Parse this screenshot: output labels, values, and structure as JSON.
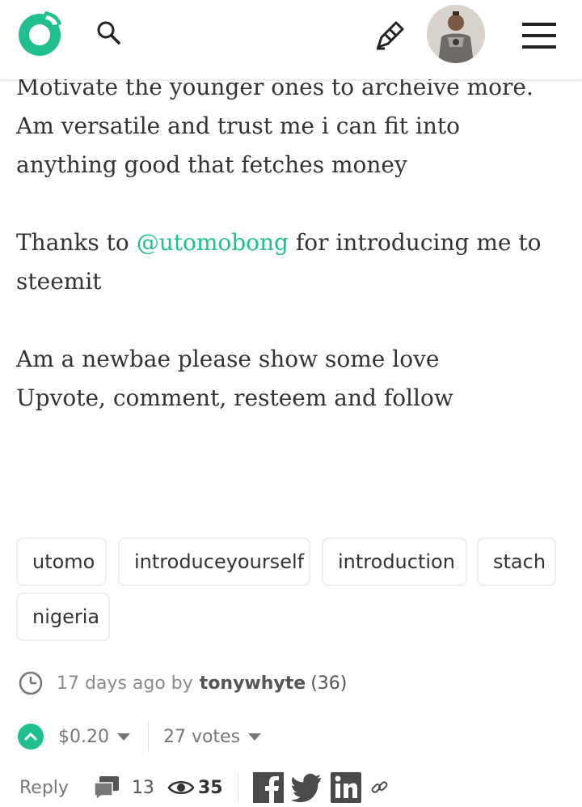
{
  "header": {
    "logo_icon": "steemit-logo-icon",
    "search_icon": "search-icon",
    "submit_icon": "pen-icon",
    "avatar": "user-avatar",
    "menu_icon": "hamburger-menu-icon",
    "accent_color": "#1fbf8f"
  },
  "post": {
    "lines": {
      "l1": "Motivate the younger ones to archeive more.",
      "l2": "Am versatile and trust me i can fit into",
      "l3": "anything good that fetches money",
      "thanks_prefix": "Thanks to ",
      "mention": "@utomobong",
      "thanks_suffix": " for introducing me to",
      "l5": "steemit",
      "l6": "Am a newbae please show some love",
      "l7": "Upvote, comment, resteem and follow"
    },
    "tags": [
      "utomo",
      "introduceyourself",
      "introduction",
      "stach",
      "nigeria"
    ]
  },
  "meta": {
    "time": "17 days ago by",
    "author": "tonywhyte",
    "reputation": "(36)"
  },
  "votes": {
    "payout": "$0.20",
    "count": "27 votes"
  },
  "actions": {
    "reply": "Reply",
    "comments": "13",
    "views": "35",
    "share_icons": [
      "facebook-icon",
      "twitter-icon",
      "linkedin-icon",
      "link-icon"
    ]
  }
}
